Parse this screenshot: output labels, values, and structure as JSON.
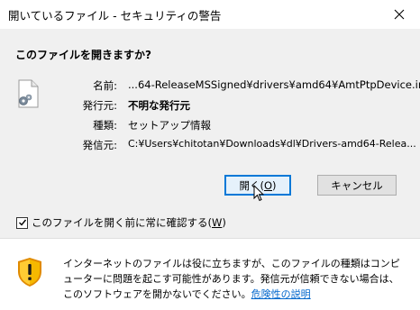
{
  "window": {
    "title": "開いているファイル - セキュリティの警告"
  },
  "dialog": {
    "question": "このファイルを開きますか?",
    "details": [
      {
        "label": "名前:",
        "value": "...64-ReleaseMSSigned¥drivers¥amd64¥AmtPtpDevice.inf",
        "bold": false
      },
      {
        "label": "発行元:",
        "value": "不明な発行元",
        "bold": true
      },
      {
        "label": "種類:",
        "value": "セットアップ情報",
        "bold": false
      },
      {
        "label": "発信元:",
        "value": "C:¥Users¥chitotan¥Downloads¥dl¥Drivers-amd64-Relea...",
        "bold": false
      }
    ],
    "buttons": {
      "open_label": "開く(",
      "open_accel": "O",
      "open_close": ")",
      "cancel_label": "キャンセル"
    },
    "checkbox": {
      "checked": true,
      "label_text": "このファイルを開く前に常に確認する(",
      "label_accel": "W",
      "label_close": ")"
    }
  },
  "footer": {
    "warning_text": "インターネットのファイルは役に立ちますが、このファイルの種類はコンピューターに問題を起こす可能性があります。発信元が信頼できない場合は、このソフトウェアを開かないでください。",
    "risk_link": "危険性の説明"
  },
  "colors": {
    "accent": "#0078d7",
    "link": "#0066cc",
    "shield_yellow": "#f5b800",
    "shield_orange": "#e08a00"
  }
}
